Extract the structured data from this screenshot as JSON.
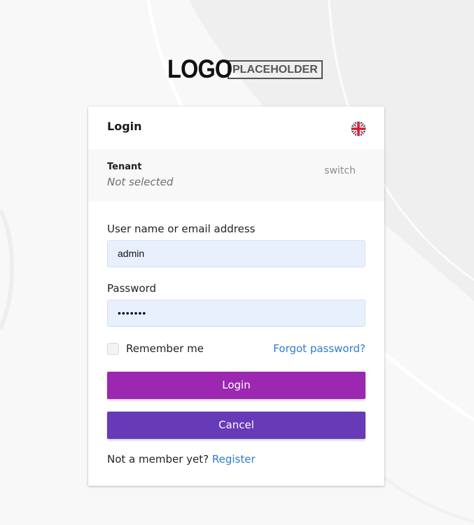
{
  "logo": {
    "main": "LOGO",
    "boxed": "PLACEHOLDER"
  },
  "card": {
    "title": "Login",
    "language_icon": "uk-flag-icon"
  },
  "tenant": {
    "label": "Tenant",
    "value": "Not selected",
    "switch_label": "switch"
  },
  "form": {
    "username_label": "User name or email address",
    "username_value": "admin",
    "password_label": "Password",
    "password_value": "•••••••",
    "remember_label": "Remember me",
    "remember_checked": false,
    "forgot_label": "Forgot password?",
    "login_button": "Login",
    "cancel_button": "Cancel",
    "register_prompt": "Not a member yet?",
    "register_link": "Register"
  },
  "colors": {
    "login_button": "#9c27b0",
    "cancel_button": "#673ab7",
    "link": "#2e7bd6",
    "input_bg": "#e8f0fe"
  }
}
